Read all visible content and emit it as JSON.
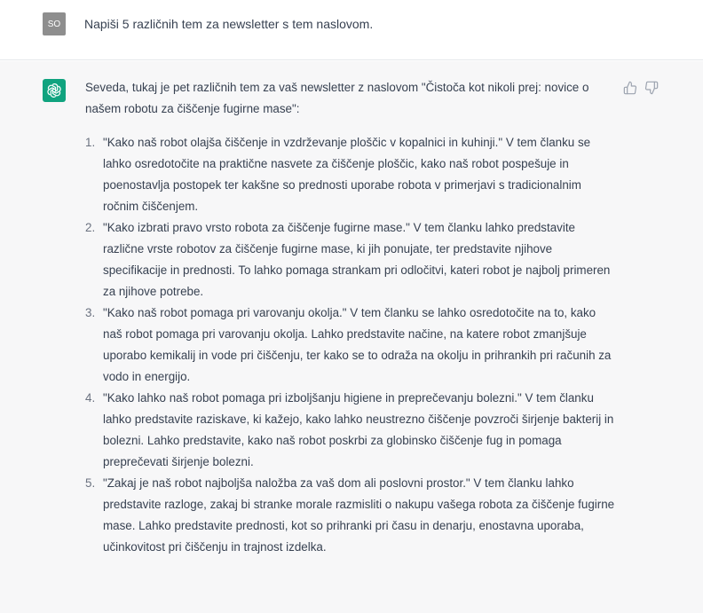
{
  "user_message": {
    "avatar_initials": "SO",
    "text": "Napiši 5 različnih tem za newsletter s tem naslovom."
  },
  "assistant_message": {
    "intro": "Seveda, tukaj je pet različnih tem za vaš newsletter z naslovom \"Čistoča kot nikoli prej: novice o našem robotu za čiščenje fugirne mase\":",
    "items": [
      {
        "number": "1.",
        "text": "\"Kako naš robot olajša čiščenje in vzdrževanje ploščic v kopalnici in kuhinji.\" V tem članku se lahko osredotočite na praktične nasvete za čiščenje ploščic, kako naš robot pospešuje in poenostavlja postopek ter kakšne so prednosti uporabe robota v primerjavi s tradicionalnim ročnim čiščenjem."
      },
      {
        "number": "2.",
        "text": "\"Kako izbrati pravo vrsto robota za čiščenje fugirne mase.\" V tem članku lahko predstavite različne vrste robotov za čiščenje fugirne mase, ki jih ponujate, ter predstavite njihove specifikacije in prednosti. To lahko pomaga strankam pri odločitvi, kateri robot je najbolj primeren za njihove potrebe."
      },
      {
        "number": "3.",
        "text": "\"Kako naš robot pomaga pri varovanju okolja.\" V tem članku se lahko osredotočite na to, kako naš robot pomaga pri varovanju okolja. Lahko predstavite načine, na katere robot zmanjšuje uporabo kemikalij in vode pri čiščenju, ter kako se to odraža na okolju in prihrankih pri računih za vodo in energijo."
      },
      {
        "number": "4.",
        "text": "\"Kako lahko naš robot pomaga pri izboljšanju higiene in preprečevanju bolezni.\" V tem članku lahko predstavite raziskave, ki kažejo, kako lahko neustrezno čiščenje povzroči širjenje bakterij in bolezni. Lahko predstavite, kako naš robot poskrbi za globinsko čiščenje fug in pomaga preprečevati širjenje bolezni."
      },
      {
        "number": "5.",
        "text": "\"Zakaj je naš robot najboljša naložba za vaš dom ali poslovni prostor.\" V tem članku lahko predstavite razloge, zakaj bi stranke morale razmisliti o nakupu vašega robota za čiščenje fugirne mase. Lahko predstavite prednosti, kot so prihranki pri času in denarju, enostavna uporaba, učinkovitost pri čiščenju in trajnost izdelka."
      }
    ]
  },
  "icons": {
    "assistant_avatar": "openai-logo-icon",
    "thumbs_up": "thumbs-up-icon",
    "thumbs_down": "thumbs-down-icon"
  },
  "colors": {
    "assistant_avatar_bg": "#10a37f",
    "user_avatar_bg": "#8e8e8e",
    "assistant_row_bg": "#f7f7f8"
  }
}
